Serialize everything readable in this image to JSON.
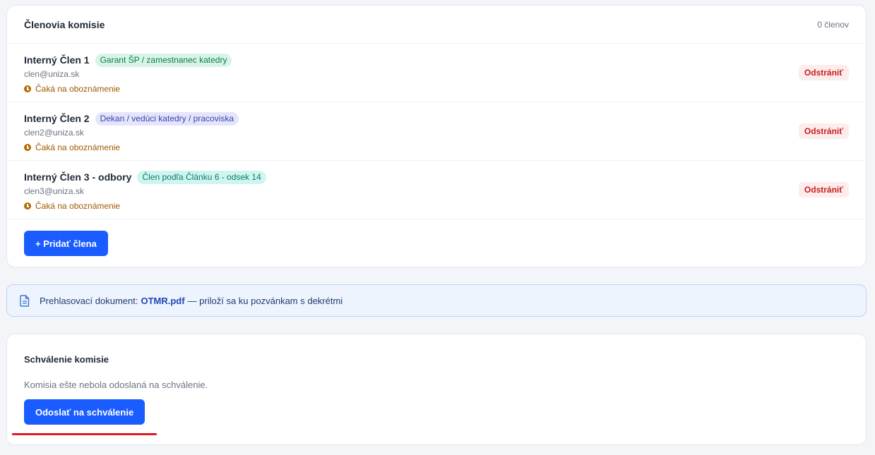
{
  "members_card": {
    "title": "Členovia komisie",
    "count": "0 členov",
    "members": [
      {
        "name": "Interný Člen 1",
        "role": "Garant ŠP / zamestnanec katedry",
        "role_color": "green",
        "email": "clen@uniza.sk",
        "status": "Čaká na oboznámenie",
        "remove_label": "Odstrániť"
      },
      {
        "name": "Interný Člen 2",
        "role": "Dekan / vedúci katedry / pracoviska",
        "role_color": "indigo",
        "email": "clen2@uniza.sk",
        "status": "Čaká na oboznámenie",
        "remove_label": "Odstrániť"
      },
      {
        "name": "Interný Člen 3 - odbory",
        "role": "Člen podľa Článku 6 - odsek 14",
        "role_color": "teal",
        "email": "clen3@uniza.sk",
        "status": "Čaká na oboznámenie",
        "remove_label": "Odstrániť"
      }
    ],
    "add_label": "+ Pridať člena"
  },
  "info_banner": {
    "icon": "document-icon",
    "prefix": "Prehlasovací dokument:",
    "document_name": "OTMR.pdf",
    "suffix": "— priloží sa ku pozvánkam s dekrétmi"
  },
  "approval_card": {
    "title": "Schválenie komisie",
    "text": "Komisia ešte nebola odoslaná na schválenie.",
    "button_label": "Odoslať na schválenie"
  },
  "colors": {
    "primary": "#1a5cff",
    "danger": "#c81e1e",
    "warning": "#a05a00",
    "annotation_underline": "#e01b24"
  }
}
